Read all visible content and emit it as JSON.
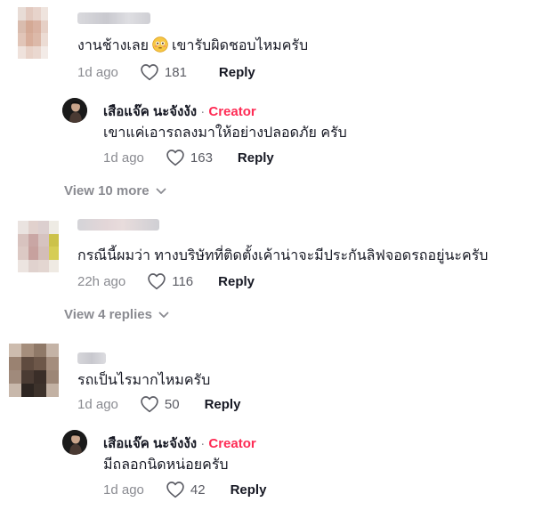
{
  "comments": [
    {
      "text": "งานช้างเลย",
      "text_after_emoji": "เขารับผิดชอบไหมครับ",
      "emoji": "flushed-face",
      "time": "1d ago",
      "likes": "181",
      "reply_label": "Reply",
      "reply": {
        "author": "เสือแจ๊ค นะจังงัง",
        "separator": "·",
        "badge": "Creator",
        "text": "เขาแค่เอารถลงมาให้อย่างปลอดภัย ครับ",
        "time": "1d ago",
        "likes": "163",
        "reply_label": "Reply"
      },
      "view_more": "View 10 more"
    },
    {
      "text": "กรณีนี้ผมว่า ทางบริษัทที่ติดตั้งเค้าน่าจะมีประกันลิฟจอดรถอยู่นะครับ",
      "time": "22h ago",
      "likes": "116",
      "reply_label": "Reply",
      "view_more": "View 4 replies"
    },
    {
      "text": "รถเป็นไรมากไหมครับ",
      "time": "1d ago",
      "likes": "50",
      "reply_label": "Reply",
      "reply": {
        "author": "เสือแจ๊ค นะจังงัง",
        "separator": "·",
        "badge": "Creator",
        "text": "มีถลอกนิดหน่อยครับ",
        "time": "1d ago",
        "likes": "42",
        "reply_label": "Reply"
      }
    }
  ],
  "colors": {
    "creator_badge": "#fe2c55",
    "muted_text": "#8a8b91",
    "primary_text": "#161823"
  }
}
